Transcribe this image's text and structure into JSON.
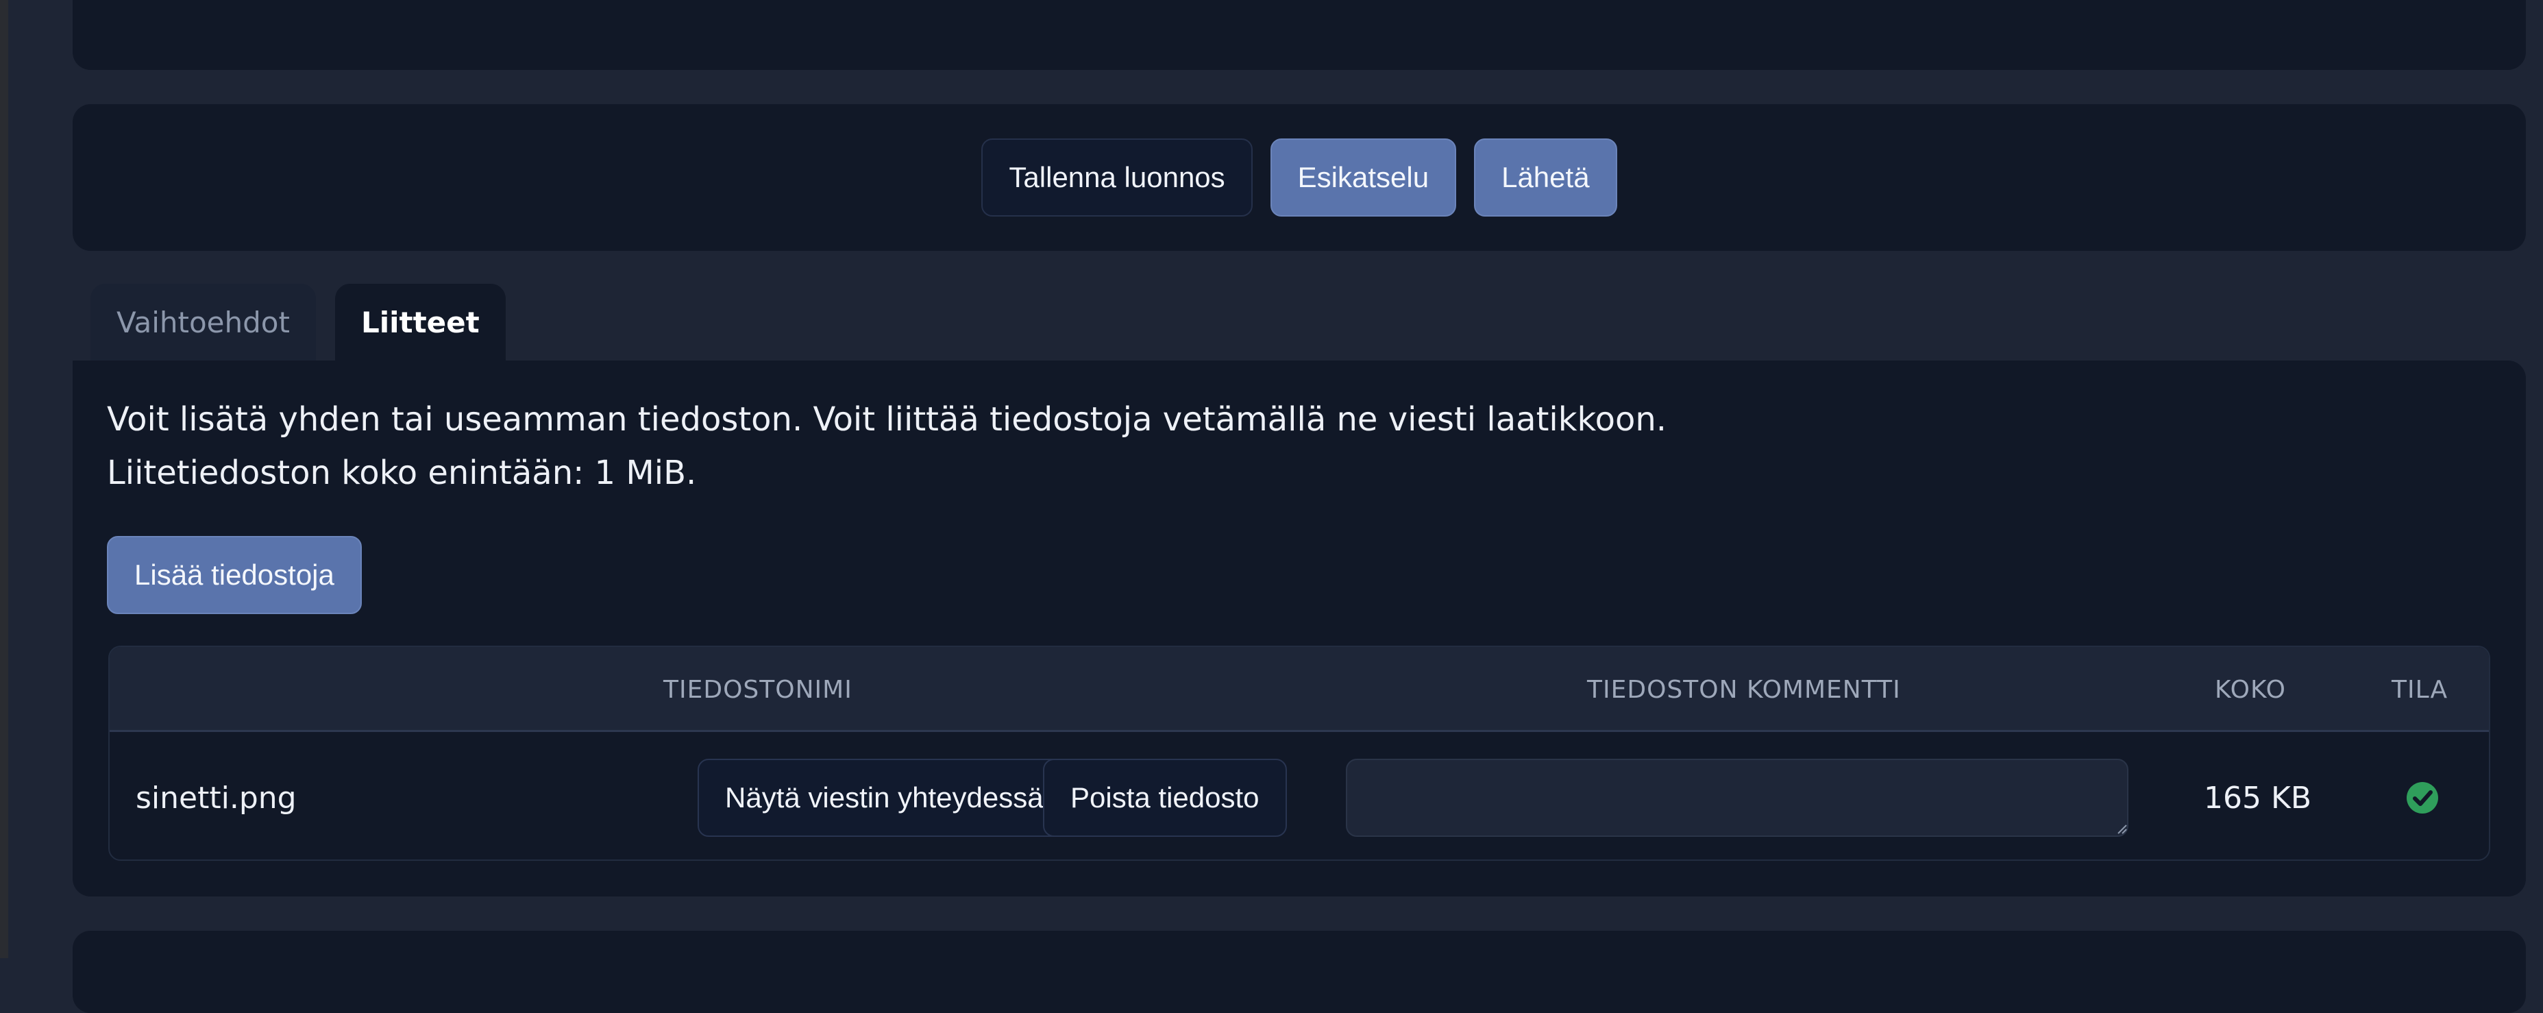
{
  "actions": {
    "save_draft": "Tallenna luonnos",
    "preview": "Esikatselu",
    "send": "Lähetä"
  },
  "tabs": [
    {
      "label": "Vaihtoehdot",
      "active": false
    },
    {
      "label": "Liitteet",
      "active": true
    }
  ],
  "attachments": {
    "help_line_1": "Voit lisätä yhden tai useamman tiedoston. Voit liittää tiedostoja vetämällä ne viesti laatikkoon.",
    "help_line_2": "Liitetiedoston koko enintään: 1 MiB.",
    "add_files": "Lisää tiedostoja",
    "columns": {
      "filename": "TIEDOSTONIMI",
      "comment": "TIEDOSTON KOMMENTTI",
      "size": "KOKO",
      "status": "TILA"
    },
    "rows": [
      {
        "name": "sinetti.png",
        "show_in_message": "Näytä viestin yhteydessä",
        "delete_file": "Poista tiedosto",
        "comment": "",
        "size": "165 KB",
        "status_icon": "check-circle-icon"
      }
    ]
  },
  "colors": {
    "primary": "#5a74ac",
    "status_ok": "#2f9e5b",
    "panel": "#111827",
    "background": "#1e2535"
  }
}
